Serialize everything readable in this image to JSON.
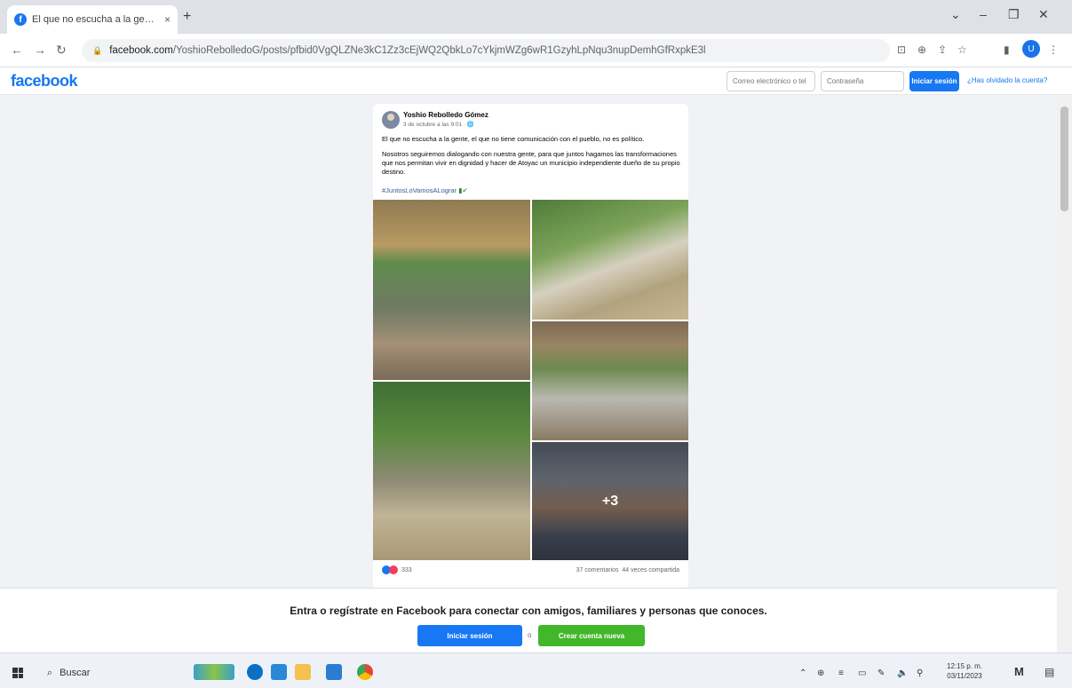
{
  "browser": {
    "tab_title": "El que no escucha a la gente, el",
    "tab_close": "×",
    "new_tab": "+",
    "url_domain": "facebook.com",
    "url_path": "/YoshioRebolledoG/posts/pfbid0VgQLZNe3kC1Zz3cEjWQ2QbkLo7cYkjmWZg6wR1GzyhLpNqu3nupDemhGfRxpkE3l",
    "profile_initial": "U"
  },
  "fb_header": {
    "logo": "facebook",
    "email_placeholder": "Correo electrónico o tel",
    "password_placeholder": "Contraseña",
    "login_label": "Iniciar sesión",
    "forgot_label": "¿Has olvidado la cuenta?"
  },
  "post": {
    "author": "Yoshio Rebolledo Gómez",
    "meta": "3 de octubre a las 9:01 · ",
    "line1": "El que no escucha a la gente, el que no tiene comunicación con el pueblo, no es político.",
    "line2": "Nosotros seguiremos dialogando con nuestra gente, para que juntos hagamos las transformaciones que nos permitan vivir en dignidad y hacer de Atoyac un municipio independiente dueño de su propio destino.",
    "hashtag": "#JuntosLoVamosALograr",
    "more_photos": "+3",
    "reaction_count": "333",
    "comments": "37 comentarios",
    "shares": "44 veces compartida"
  },
  "banner": {
    "text": "Entra o regístrate en Facebook para conectar con amigos, familiares y personas que conoces.",
    "login_label": "Iniciar sesión",
    "or_label": "o",
    "create_label": "Crear cuenta nueva"
  },
  "taskbar": {
    "search_label": "Buscar",
    "time": "12:15 p. m.",
    "date": "03/11/2023"
  }
}
